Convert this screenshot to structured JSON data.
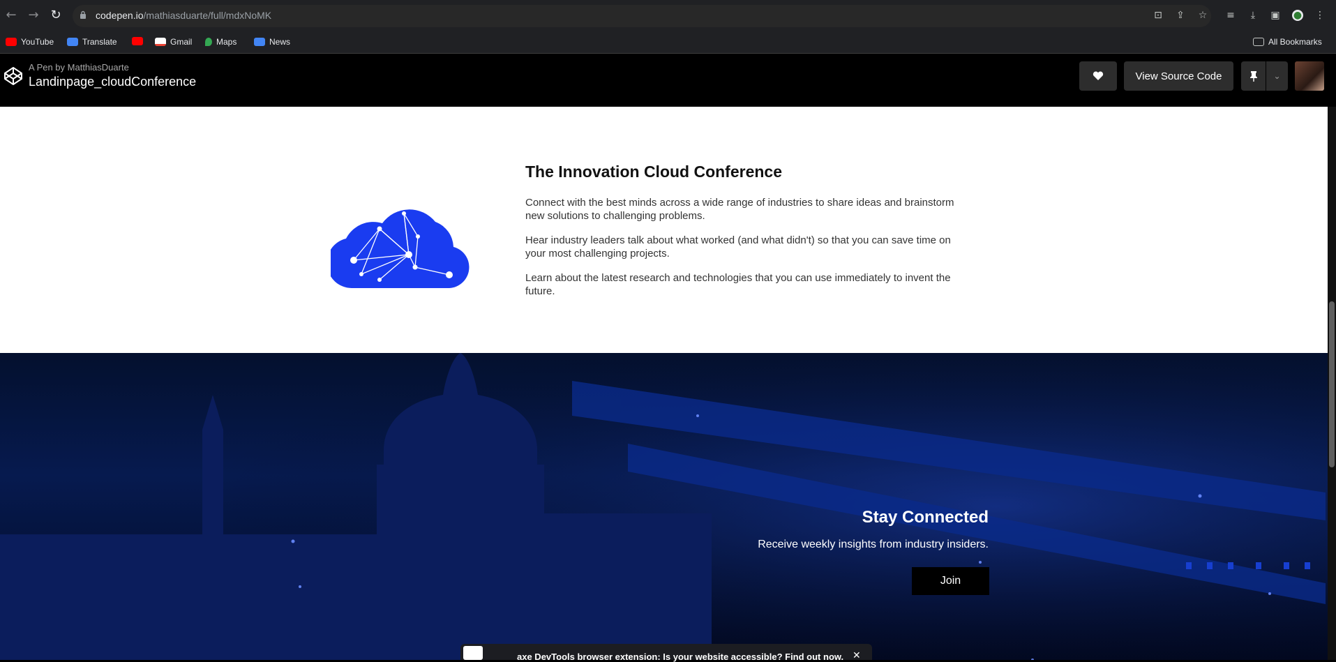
{
  "browser": {
    "url_host": "codepen.io",
    "url_path": "/mathiasduarte/full/mdxNoMK",
    "icons": [
      "back-arrow-icon",
      "forward-arrow-icon",
      "reload-icon",
      "lock-icon",
      "translate-icon",
      "share-icon",
      "star-icon",
      "reading-list-icon",
      "download-icon",
      "sidebar-icon",
      "profile-icon",
      "kebab-menu-icon"
    ]
  },
  "bookmarks": {
    "items": [
      {
        "label": "YouTube",
        "color": "#ff0000"
      },
      {
        "label": "Translate",
        "color": "#4285f4"
      },
      {
        "label": "",
        "color": "#ff0000"
      },
      {
        "label": "Gmail",
        "color": "#ea4335"
      },
      {
        "label": "Maps",
        "color": "#34a853"
      },
      {
        "label": "News",
        "color": "#4285f4"
      }
    ],
    "all_bookmarks": "All Bookmarks"
  },
  "codepen": {
    "by": "A Pen by MatthiasDuarte",
    "title": "Landinpage_cloudConference",
    "view_source": "View Source Code",
    "heart_icon": "heart-icon",
    "pin_icon": "pin-icon"
  },
  "info": {
    "title": "The Innovation Cloud Conference",
    "paragraphs": [
      "Connect with the best minds across a wide range of industries to share ideas and brainstorm new solutions to challenging problems.",
      "Hear industry leaders talk about what worked (and what didn't) so that you can save time on your most challenging projects.",
      "Learn about the latest research and technologies that you can use immediately to invent the future."
    ],
    "cloud_color": "#1a3cf0"
  },
  "stay": {
    "title": "Stay Connected",
    "subtitle": "Receive weekly insights from industry insiders.",
    "join": "Join"
  },
  "axe_banner": {
    "text": "axe DevTools browser extension: Is your website accessible? Find out now.",
    "close": "✕"
  }
}
